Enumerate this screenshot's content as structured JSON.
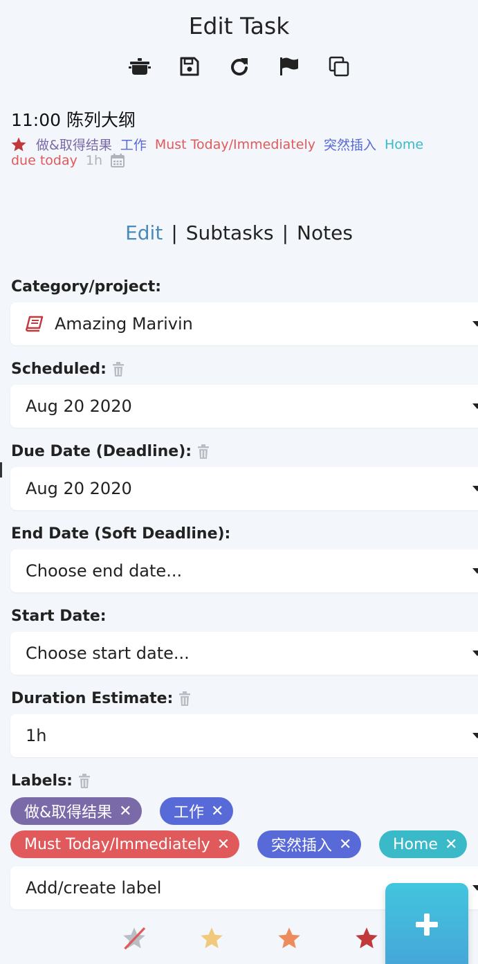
{
  "header": {
    "title": "Edit Task",
    "toolbar": [
      {
        "icon": "pot-icon"
      },
      {
        "icon": "save-icon"
      },
      {
        "icon": "redo-icon"
      },
      {
        "icon": "flag-icon"
      },
      {
        "icon": "copy-icon"
      }
    ]
  },
  "task": {
    "title": "11:00 陈列大纲",
    "meta": {
      "star_color": "#c0393b",
      "category": "做&取得结果",
      "label_work": "工作",
      "label_must": "Must Today/Immediately",
      "label_sudden": "突然插入",
      "label_home": "Home",
      "due": "due today",
      "duration": "1h"
    }
  },
  "tabs": {
    "edit": "Edit",
    "subtasks": "Subtasks",
    "notes": "Notes",
    "separator": "|"
  },
  "fields": {
    "category": {
      "label": "Category/project:",
      "value": "Amazing Marivin"
    },
    "scheduled": {
      "label": "Scheduled:",
      "value": "Aug 20 2020"
    },
    "due": {
      "label": "Due Date (Deadline):",
      "value": "Aug 20 2020"
    },
    "end": {
      "label": "End Date (Soft Deadline):",
      "placeholder": "Choose end date..."
    },
    "start": {
      "label": "Start Date:",
      "placeholder": "Choose start date..."
    },
    "duration": {
      "label": "Duration Estimate:",
      "value": "1h"
    },
    "labels": {
      "label": "Labels:",
      "add_placeholder": "Add/create label"
    }
  },
  "chips": [
    {
      "text": "做&取得结果",
      "color": "#7b6aa8"
    },
    {
      "text": "工作",
      "color": "#5869d8"
    },
    {
      "text": "Must Today/Immediately",
      "color": "#e0595b"
    },
    {
      "text": "突然插入",
      "color": "#5869d8"
    },
    {
      "text": "Home",
      "color": "#3ab9c9"
    }
  ],
  "chip_close": "✕",
  "colors": {
    "accent": "#4a8ab8",
    "category_text": "#7b6aa8",
    "work_text": "#5869d8",
    "must_text": "#e0595b",
    "home_text": "#3ab9c9",
    "muted": "#b0b4ba"
  },
  "priority_stars": [
    {
      "name": "no-priority",
      "color": "#b9bec6"
    },
    {
      "name": "low",
      "color": "#f0c97a"
    },
    {
      "name": "medium",
      "color": "#ee8b5b"
    },
    {
      "name": "high",
      "color": "#c0393b"
    }
  ],
  "fab": {
    "icon": "plus-icon"
  }
}
